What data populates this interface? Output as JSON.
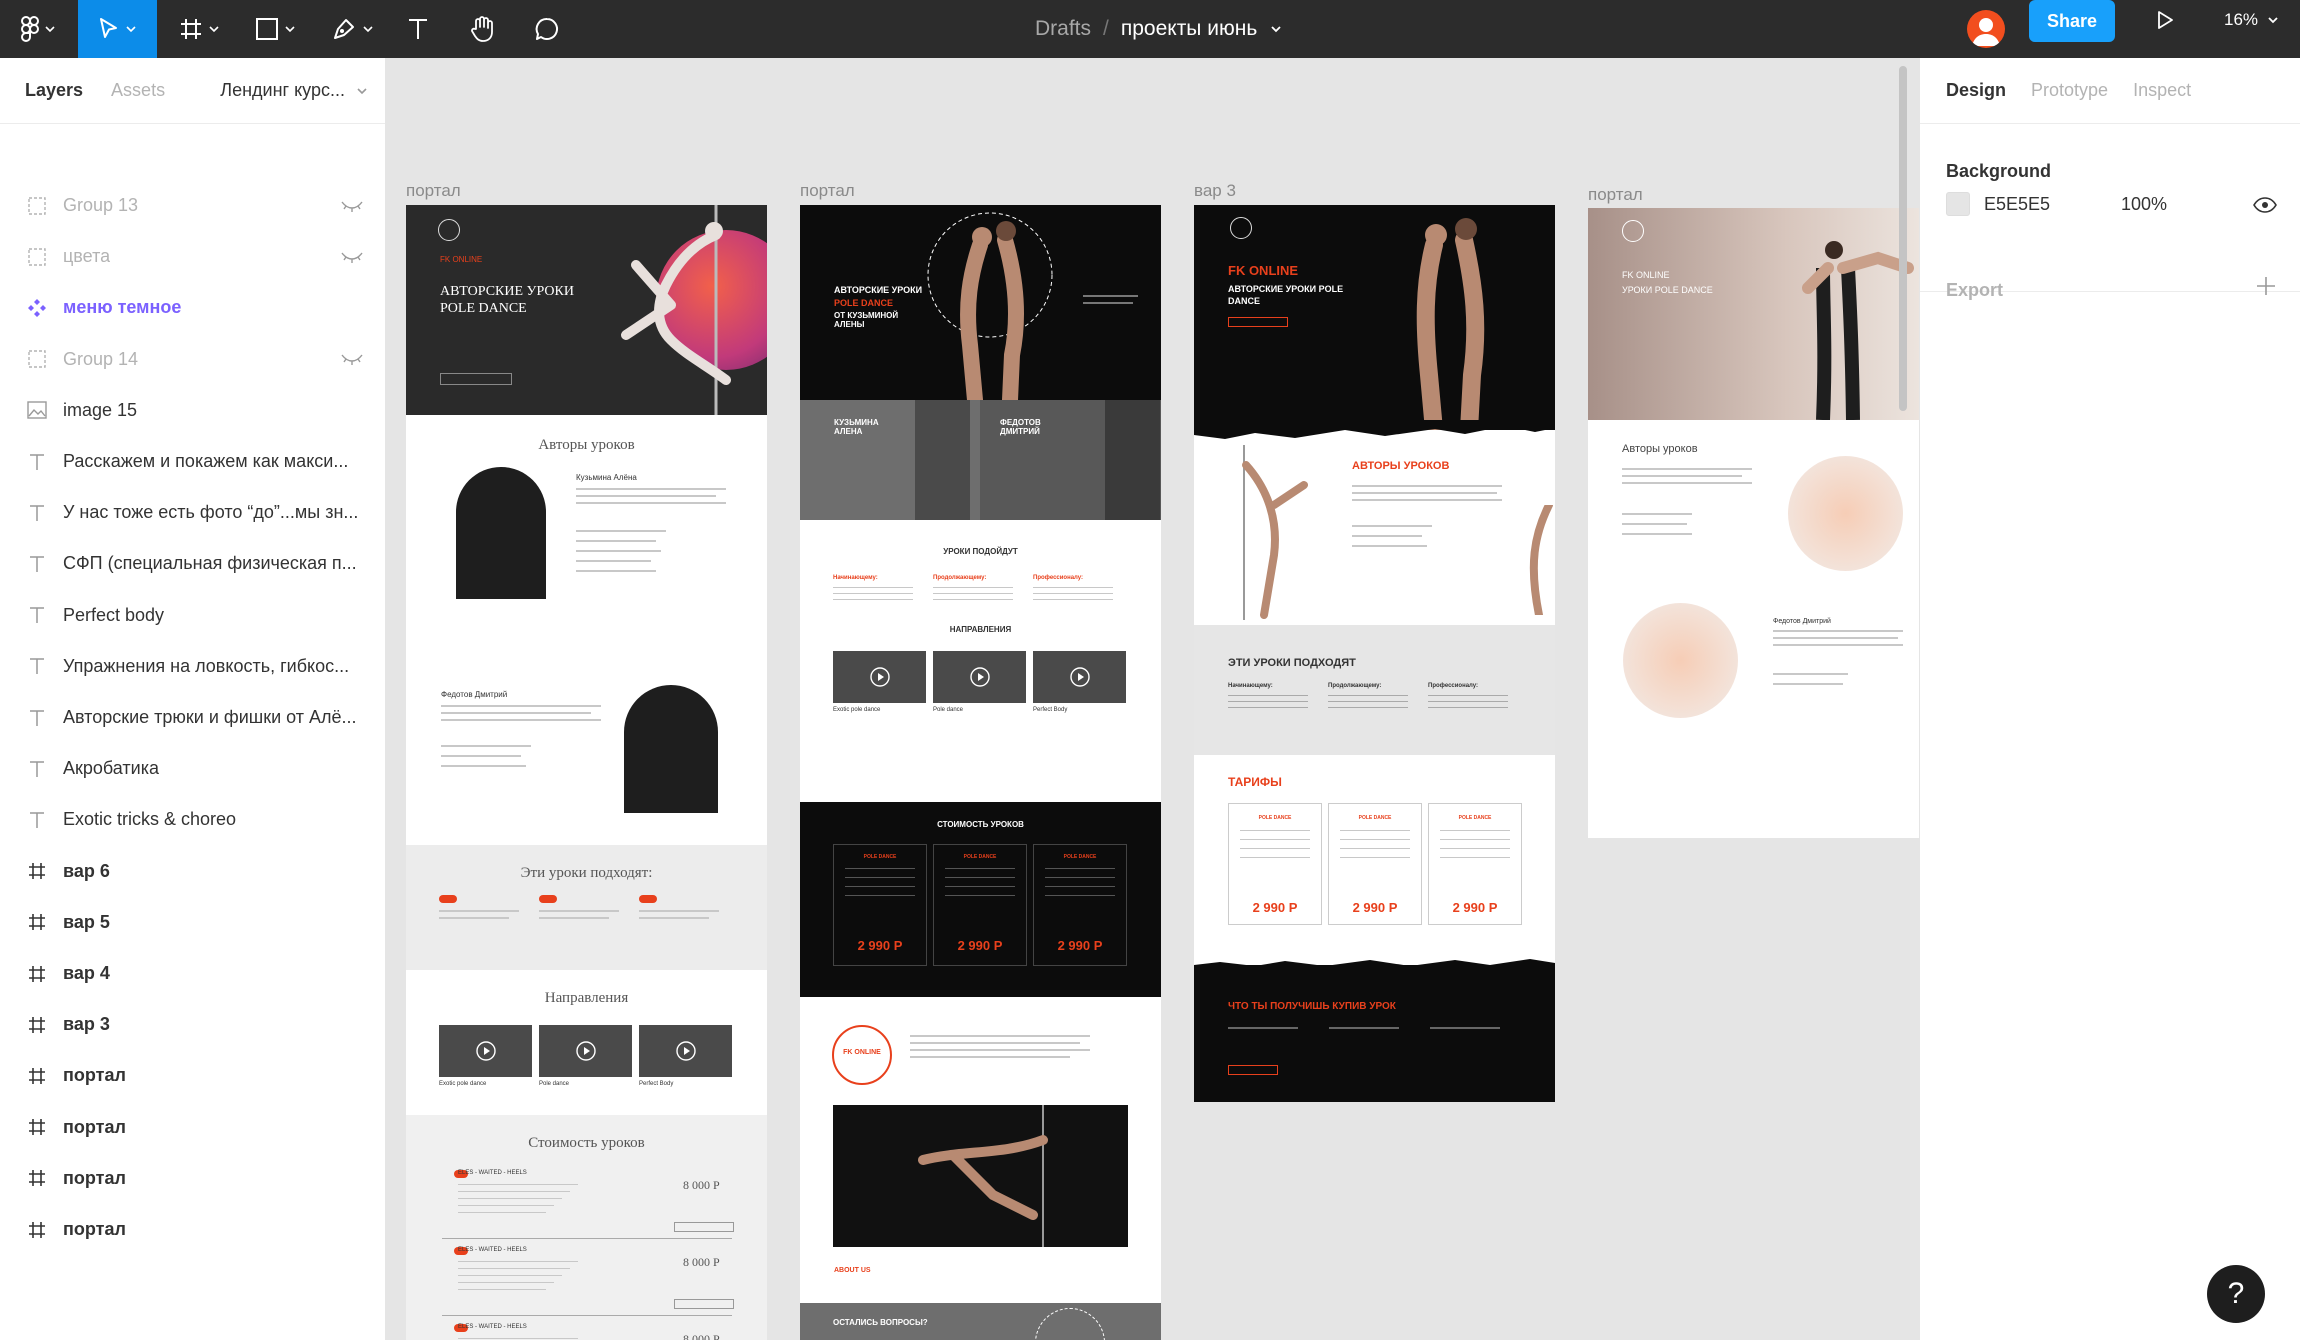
{
  "toolbar": {
    "file": {
      "project": "Drafts",
      "separator": "/",
      "name": "проекты июнь"
    },
    "share_label": "Share",
    "zoom": "16%",
    "tools": [
      "figma-menu-icon",
      "move-icon",
      "frame-icon",
      "shape-icon",
      "pen-icon",
      "text-icon",
      "hand-icon",
      "comment-icon"
    ]
  },
  "left_panel": {
    "tabs": [
      "Layers",
      "Assets"
    ],
    "page": "Лендинг курс...",
    "layers": [
      {
        "name": "Group 13",
        "type": "group",
        "hidden": true
      },
      {
        "name": "цвета",
        "type": "group",
        "hidden": true
      },
      {
        "name": "меню темное",
        "type": "component",
        "hidden": false
      },
      {
        "name": "Group 14",
        "type": "group",
        "hidden": true
      },
      {
        "name": "image 15",
        "type": "image",
        "hidden": false
      },
      {
        "name": "Расскажем и покажем как макси...",
        "type": "text",
        "hidden": false
      },
      {
        "name": "У нас тоже есть фото “до”...мы зн...",
        "type": "text",
        "hidden": false
      },
      {
        "name": "СФП (специальная физическая п...",
        "type": "text",
        "hidden": false
      },
      {
        "name": "Perfect body",
        "type": "text",
        "hidden": false
      },
      {
        "name": "Упражнения на ловкость, гибкос...",
        "type": "text",
        "hidden": false
      },
      {
        "name": "Авторские трюки и фишки от Алё...",
        "type": "text",
        "hidden": false
      },
      {
        "name": "Акробатика",
        "type": "text",
        "hidden": false
      },
      {
        "name": "Exotic tricks & choreo",
        "type": "text",
        "hidden": false
      },
      {
        "name": "вар 6",
        "type": "frame",
        "hidden": false
      },
      {
        "name": "вар 5",
        "type": "frame",
        "hidden": false
      },
      {
        "name": "вар 4",
        "type": "frame",
        "hidden": false
      },
      {
        "name": "вар 3",
        "type": "frame",
        "hidden": false
      },
      {
        "name": "портал",
        "type": "frame",
        "hidden": false
      },
      {
        "name": "портал",
        "type": "frame",
        "hidden": false
      },
      {
        "name": "портал",
        "type": "frame",
        "hidden": false
      },
      {
        "name": "портал",
        "type": "frame",
        "hidden": false
      }
    ]
  },
  "canvas": {
    "frames": [
      {
        "label": "портал",
        "brand": "FK ONLINE",
        "hero_title": "АВТОРСКИЕ УРОКИ POLE DANCE",
        "authors_title": "Авторы уроков",
        "author1": "Кузьмина Алёна",
        "author2": "Федотов Дмитрий",
        "suits_title": "Эти уроки подходят:",
        "dirs_title": "Направления",
        "dirs": [
          "Exotic pole dance",
          "Pole dance",
          "Perfect Body"
        ],
        "price_title": "Стоимость уроков",
        "price_rows": [
          {
            "name": "ELES - WAITED - HEELS",
            "price": "8 000 Р"
          },
          {
            "name": "ELES - WAITED - HEELS",
            "price": "8 000 Р"
          },
          {
            "name": "ELES - WAITED - HEELS",
            "price": "8 000 Р"
          }
        ]
      },
      {
        "label": "портал",
        "hero_title": "АВТОРСКИЕ УРОКИ",
        "hero_accent": "POLE DANCE",
        "hero_sub": "ОТ КУЗЬМИНОЙ АЛЕНЫ",
        "author1": "КУЗЬМИНА АЛЕНА",
        "author2": "ФЕДОТОВ ДМИТРИЙ",
        "suits_title": "УРОКИ ПОДОЙДУТ",
        "suits": [
          "Начинающему:",
          "Продолжающему:",
          "Профессионалу:"
        ],
        "dirs_title": "НАПРАВЛЕНИЯ",
        "dirs": [
          "Exotic pole dance",
          "Pole dance",
          "Perfect Body"
        ],
        "price_title": "СТОИМОСТЬ УРОКОВ",
        "plan_name": "POLE DANCE",
        "prices": [
          "2 990 Р",
          "2 990 Р",
          "2 990 Р"
        ],
        "about": "ABOUT US",
        "questions": "ОСТАЛИСЬ ВОПРОСЫ?",
        "stamp": "FK ONLINE"
      },
      {
        "label": "вар 3",
        "brand": "FK ONLINE",
        "hero_title": "АВТОРСКИЕ УРОКИ POLE DANCE",
        "authors_title": "АВТОРЫ УРОКОВ",
        "suits_title": "ЭТИ УРОКИ ПОДХОДЯТ",
        "suits": [
          "Начинающему:",
          "Продолжающему:",
          "Профессионалу:"
        ],
        "tariffs_title": "ТАРИФЫ",
        "plan_name": "POLE DANCE",
        "prices": [
          "2 990 Р",
          "2 990 Р",
          "2 990 Р"
        ],
        "what_title": "ЧТО ТЫ ПОЛУЧИШЬ КУПИВ УРОК"
      },
      {
        "label": "портал",
        "brand": "FK ONLINE",
        "hero_title": "УРОКИ POLE DANCE",
        "authors_title": "Авторы уроков",
        "author2": "Федотов Дмитрий"
      }
    ]
  },
  "right_panel": {
    "tabs": [
      "Design",
      "Prototype",
      "Inspect"
    ],
    "background": {
      "title": "Background",
      "hex": "E5E5E5",
      "opacity": "100%",
      "color": "#E5E5E5"
    },
    "export_label": "Export"
  },
  "help_label": "?",
  "colors": {
    "accent": "#0c8ce9",
    "share": "#18a0fb",
    "brand_orange": "#e8401c",
    "dark": "#2c2c2c",
    "component": "#7b61ff"
  }
}
